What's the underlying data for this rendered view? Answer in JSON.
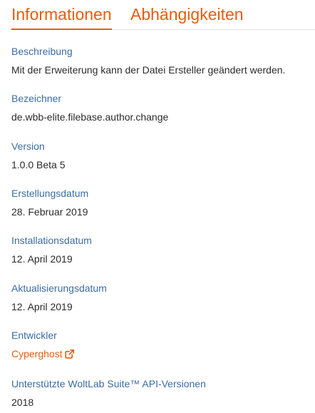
{
  "tabs": [
    {
      "label": "Informationen",
      "active": true
    },
    {
      "label": "Abhängigkeiten",
      "active": false
    }
  ],
  "fields": {
    "description": {
      "label": "Beschreibung",
      "value": "Mit der Erweiterung kann der Datei Ersteller geändert werden."
    },
    "identifier": {
      "label": "Bezeichner",
      "value": "de.wbb-elite.filebase.author.change"
    },
    "version": {
      "label": "Version",
      "value": "1.0.0 Beta 5"
    },
    "creation_date": {
      "label": "Erstellungsdatum",
      "value": "28. Februar 2019"
    },
    "install_date": {
      "label": "Installationsdatum",
      "value": "12. April 2019"
    },
    "update_date": {
      "label": "Aktualisierungsdatum",
      "value": "12. April 2019"
    },
    "developer": {
      "label": "Entwickler",
      "value": "Cyperghost",
      "icon": "external-link-icon"
    },
    "api_versions": {
      "label": "Unterstützte WoltLab Suite™ API-Versionen",
      "value": "2018"
    }
  },
  "colors": {
    "accent": "#e65d0f",
    "label": "#3b6ca5",
    "text": "#2b2b2b",
    "divider": "#dfe3e8"
  }
}
